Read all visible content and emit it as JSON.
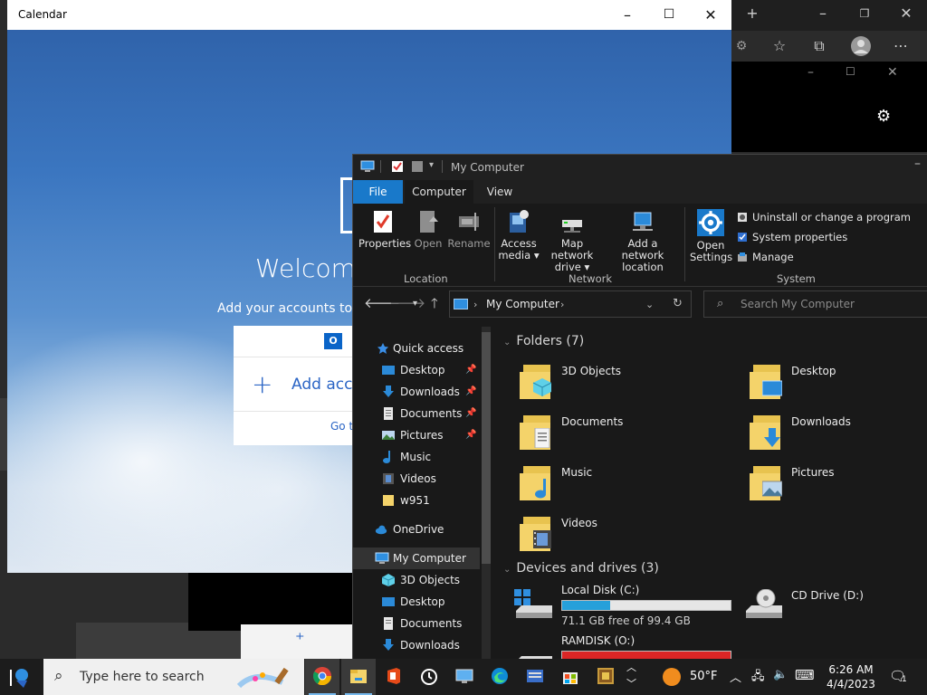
{
  "calendar": {
    "title": "Calendar",
    "welcome": "Welcome",
    "subtitle": "Add your accounts to ke",
    "add_account": "Add acco",
    "goto": "Go t",
    "outlook_letter": "O"
  },
  "explorer": {
    "title": "My Computer",
    "tabs": [
      "File",
      "Computer",
      "View"
    ],
    "ribbon": {
      "buttons": {
        "properties": "Properties",
        "open": "Open",
        "rename": "Rename",
        "access_media_1": "Access",
        "access_media_2": "media",
        "map_drive_1": "Map network",
        "map_drive_2": "drive",
        "add_location_1": "Add a network",
        "add_location_2": "location",
        "open_settings_1": "Open",
        "open_settings_2": "Settings"
      },
      "small": {
        "uninstall": "Uninstall or change a program",
        "sysprops": "System properties",
        "manage": "Manage"
      },
      "groups": {
        "location": "Location",
        "network": "Network",
        "system": "System"
      }
    },
    "address": "My Computer",
    "search_placeholder": "Search My Computer",
    "nav": {
      "quick_access": "Quick access",
      "desktop": "Desktop",
      "downloads": "Downloads",
      "documents": "Documents",
      "pictures": "Pictures",
      "music": "Music",
      "videos": "Videos",
      "w951": "w951",
      "onedrive": "OneDrive",
      "my_computer": "My Computer",
      "objects3d": "3D Objects",
      "desktop2": "Desktop",
      "documents2": "Documents",
      "downloads2": "Downloads"
    },
    "folders_header": "Folders (7)",
    "folders": {
      "objects3d": "3D Objects",
      "desktop": "Desktop",
      "documents": "Documents",
      "downloads": "Downloads",
      "music": "Music",
      "pictures": "Pictures",
      "videos": "Videos"
    },
    "drives_header": "Devices and drives (3)",
    "drives": {
      "c_name": "Local Disk (C:)",
      "c_free": "71.1 GB free of 99.4 GB",
      "c_used_fraction": 0.285,
      "d_name": "CD Drive (D:)",
      "o_name": "RAMDISK (O:)",
      "o_used_fraction": 1.0
    }
  },
  "taskbar": {
    "search_placeholder": "Type here to search",
    "weather": "50°F",
    "time": "6:26 AM",
    "date": "4/4/2023",
    "notifications_count": "1"
  },
  "colors": {
    "accent": "#1979ca",
    "drive_fill": "#26a0da",
    "ramdisk_fill": "#da2626"
  }
}
